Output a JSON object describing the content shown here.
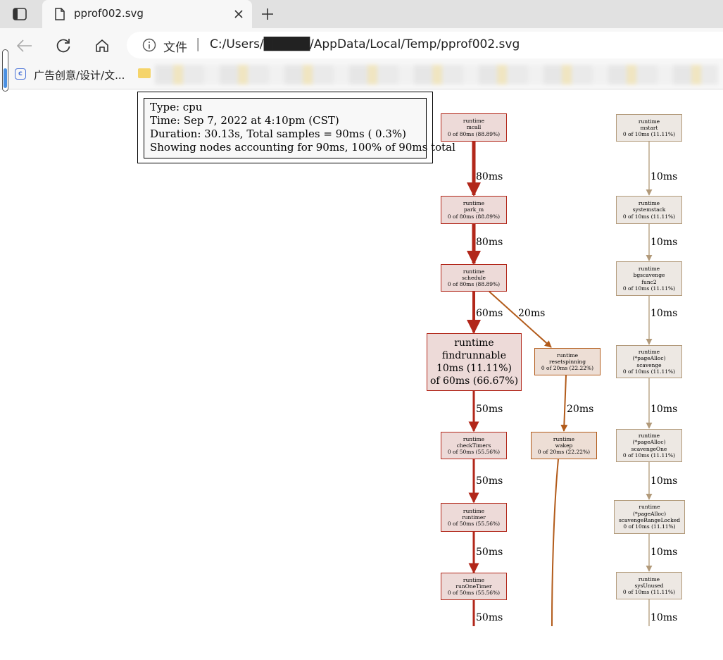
{
  "browser": {
    "tab_title": "pprof002.svg",
    "address_label": "文件",
    "address_sep": "|",
    "url": "C:/Users/█████/AppData/Local/Temp/pprof002.svg",
    "bookmark_label": "广告创意/设计/文..."
  },
  "legend": {
    "type": "Type: cpu",
    "time": "Time: Sep 7, 2022 at 4:10pm (CST)",
    "duration": "Duration: 30.13s, Total samples = 90ms (  0.3%)",
    "showing": "Showing nodes accounting for 90ms, 100% of 90ms total"
  },
  "nodes": {
    "mcall": {
      "l1": "runtime",
      "l2": "mcall",
      "l3": "0 of 80ms (88.89%)"
    },
    "park_m": {
      "l1": "runtime",
      "l2": "park_m",
      "l3": "0 of 80ms (88.89%)"
    },
    "schedule": {
      "l1": "runtime",
      "l2": "schedule",
      "l3": "0 of 80ms (88.89%)"
    },
    "findrunnable": {
      "l1": "runtime",
      "l2": "findrunnable",
      "l3": "10ms (11.11%)",
      "l4": "of 60ms (66.67%)"
    },
    "resetspinning": {
      "l1": "runtime",
      "l2": "resetspinning",
      "l3": "0 of 20ms (22.22%)"
    },
    "wakep": {
      "l1": "runtime",
      "l2": "wakep",
      "l3": "0 of 20ms (22.22%)"
    },
    "checkTimers": {
      "l1": "runtime",
      "l2": "checkTimers",
      "l3": "0 of 50ms (55.56%)"
    },
    "runtimer": {
      "l1": "runtime",
      "l2": "runtimer",
      "l3": "0 of 50ms (55.56%)"
    },
    "runOneTimer": {
      "l1": "runtime",
      "l2": "runOneTimer",
      "l3": "0 of 50ms (55.56%)"
    },
    "mstart": {
      "l1": "runtime",
      "l2": "mstart",
      "l3": "0 of 10ms (11.11%)"
    },
    "systemstack": {
      "l1": "runtime",
      "l2": "systemstack",
      "l3": "0 of 10ms (11.11%)"
    },
    "bgscavenge": {
      "l1": "runtime",
      "l2": "bgscavenge",
      "l3": "func2",
      "l4": "0 of 10ms (11.11%)"
    },
    "scavenge": {
      "l1": "runtime",
      "l2": "(*pageAlloc)",
      "l3": "scavenge",
      "l4": "0 of 10ms (11.11%)"
    },
    "scavengeOne": {
      "l1": "runtime",
      "l2": "(*pageAlloc)",
      "l3": "scavengeOne",
      "l4": "0 of 10ms (11.11%)"
    },
    "scavengeRangeLocked": {
      "l1": "runtime",
      "l2": "(*pageAlloc)",
      "l3": "scavengeRangeLocked",
      "l4": "0 of 10ms (11.11%)"
    },
    "sysUnused": {
      "l1": "runtime",
      "l2": "sysUnused",
      "l3": "0 of 10ms (11.11%)"
    }
  },
  "edges": {
    "mcall_park": "80ms",
    "park_schedule": "80ms",
    "schedule_find": "60ms",
    "schedule_reset": "20ms",
    "reset_wakep": "20ms",
    "find_check": "50ms",
    "check_runtimer": "50ms",
    "runtimer_runone": "50ms",
    "runone_below": "50ms",
    "mstart_sys": "10ms",
    "sys_bg": "10ms",
    "bg_scav": "10ms",
    "scav_one": "10ms",
    "one_range": "10ms",
    "range_unused": "10ms",
    "unused_below": "10ms"
  },
  "colors": {
    "hot": "#b2271a",
    "warm": "#b25b1a",
    "cool": "#b29a7a"
  }
}
